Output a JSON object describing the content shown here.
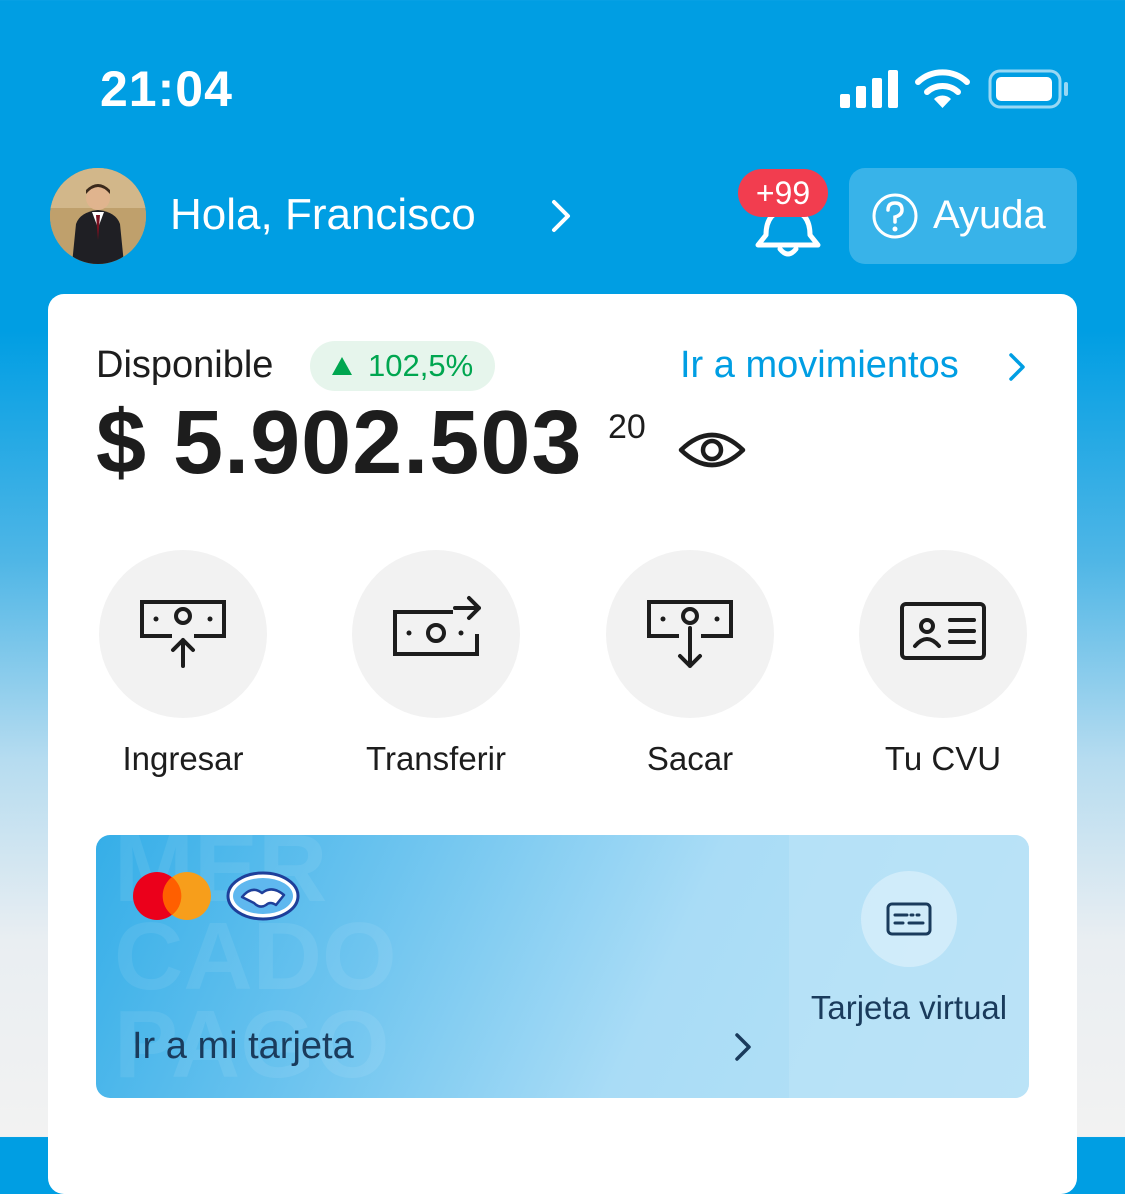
{
  "status_bar": {
    "time": "21:04",
    "icons": [
      "cellular-signal-icon",
      "wifi-icon",
      "battery-icon"
    ]
  },
  "header": {
    "greeting": "Hola, Francisco",
    "notifications_badge": "+99",
    "help_label": "Ayuda"
  },
  "balance": {
    "label": "Disponible",
    "growth": "102,5%",
    "movements_link": "Ir a movimientos",
    "amount": "$ 5.902.503",
    "cents": "20"
  },
  "actions": [
    {
      "label": "Ingresar",
      "icon": "money-in-icon"
    },
    {
      "label": "Transferir",
      "icon": "transfer-icon"
    },
    {
      "label": "Sacar",
      "icon": "money-out-icon"
    },
    {
      "label": "Tu CVU",
      "icon": "id-card-icon"
    }
  ],
  "card_section": {
    "go_to_card": "Ir a mi tarjeta",
    "virtual_card_label": "Tarjeta virtual",
    "watermark": "MER\nCADO\nPAGO"
  },
  "colors": {
    "brand_blue": "#009ee3",
    "positive_green": "#00a650",
    "badge_red": "#f23d4f"
  }
}
